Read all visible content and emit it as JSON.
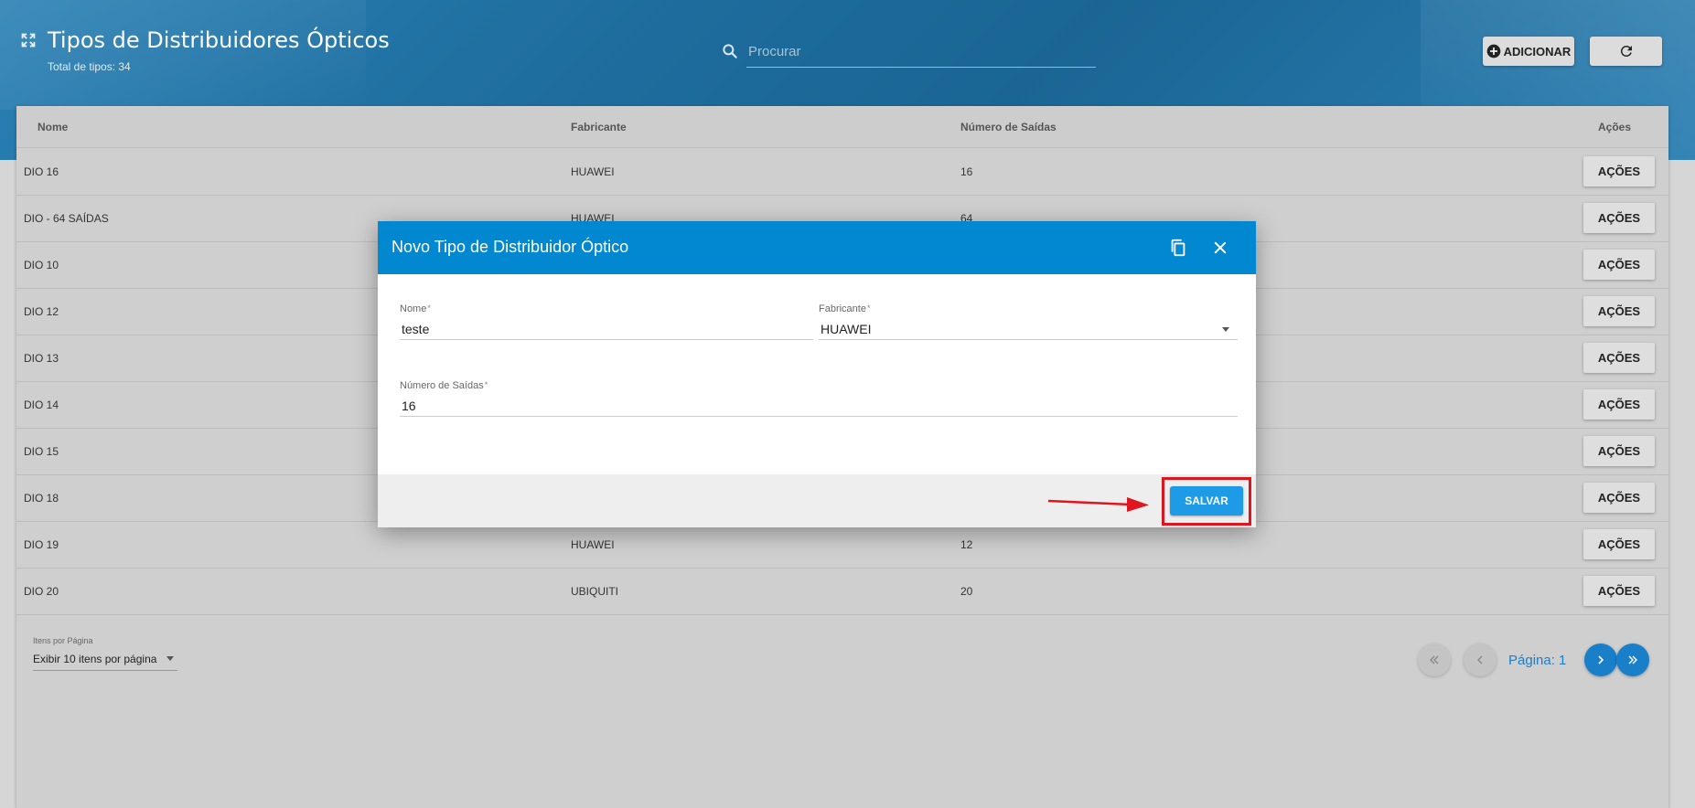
{
  "header": {
    "title": "Tipos de Distribuidores Ópticos",
    "subtitle": "Total de tipos: 34",
    "search_placeholder": "Procurar",
    "add_label": "ADICIONAR"
  },
  "table": {
    "columns": [
      "Nome",
      "Fabricante",
      "Número de Saídas",
      "Ações"
    ],
    "rows": [
      {
        "nome": "DIO 16",
        "fabricante": "HUAWEI",
        "saidas": "16",
        "acao": "AÇÕES"
      },
      {
        "nome": "DIO - 64 SAÍDAS",
        "fabricante": "HUAWEI",
        "saidas": "64",
        "acao": "AÇÕES"
      },
      {
        "nome": "DIO 10",
        "fabricante": "",
        "saidas": "",
        "acao": "AÇÕES"
      },
      {
        "nome": "DIO 12",
        "fabricante": "",
        "saidas": "",
        "acao": "AÇÕES"
      },
      {
        "nome": "DIO 13",
        "fabricante": "",
        "saidas": "",
        "acao": "AÇÕES"
      },
      {
        "nome": "DIO 14",
        "fabricante": "",
        "saidas": "",
        "acao": "AÇÕES"
      },
      {
        "nome": "DIO 15",
        "fabricante": "",
        "saidas": "",
        "acao": "AÇÕES"
      },
      {
        "nome": "DIO 18",
        "fabricante": "",
        "saidas": "",
        "acao": "AÇÕES"
      },
      {
        "nome": "DIO 19",
        "fabricante": "HUAWEI",
        "saidas": "12",
        "acao": "AÇÕES"
      },
      {
        "nome": "DIO 20",
        "fabricante": "UBIQUITI",
        "saidas": "20",
        "acao": "AÇÕES"
      }
    ]
  },
  "pagination": {
    "items_label": "Itens por Página",
    "items_value": "Exibir 10 itens por página",
    "page_label": "Página: 1"
  },
  "dialog": {
    "title": "Novo Tipo de Distribuidor Óptico",
    "nome_label": "Nome",
    "nome_value": "teste",
    "fabricante_label": "Fabricante",
    "fabricante_value": "HUAWEI",
    "saidas_label": "Número de Saídas",
    "saidas_value": "16",
    "required_mark": "*",
    "save_label": "SALVAR"
  },
  "colors": {
    "header": "#1e6d9e",
    "dialog_header": "#0288d1",
    "save_button": "#1e9be6",
    "pagination_active": "#1a7fc9",
    "annotation": "#e0161e"
  }
}
